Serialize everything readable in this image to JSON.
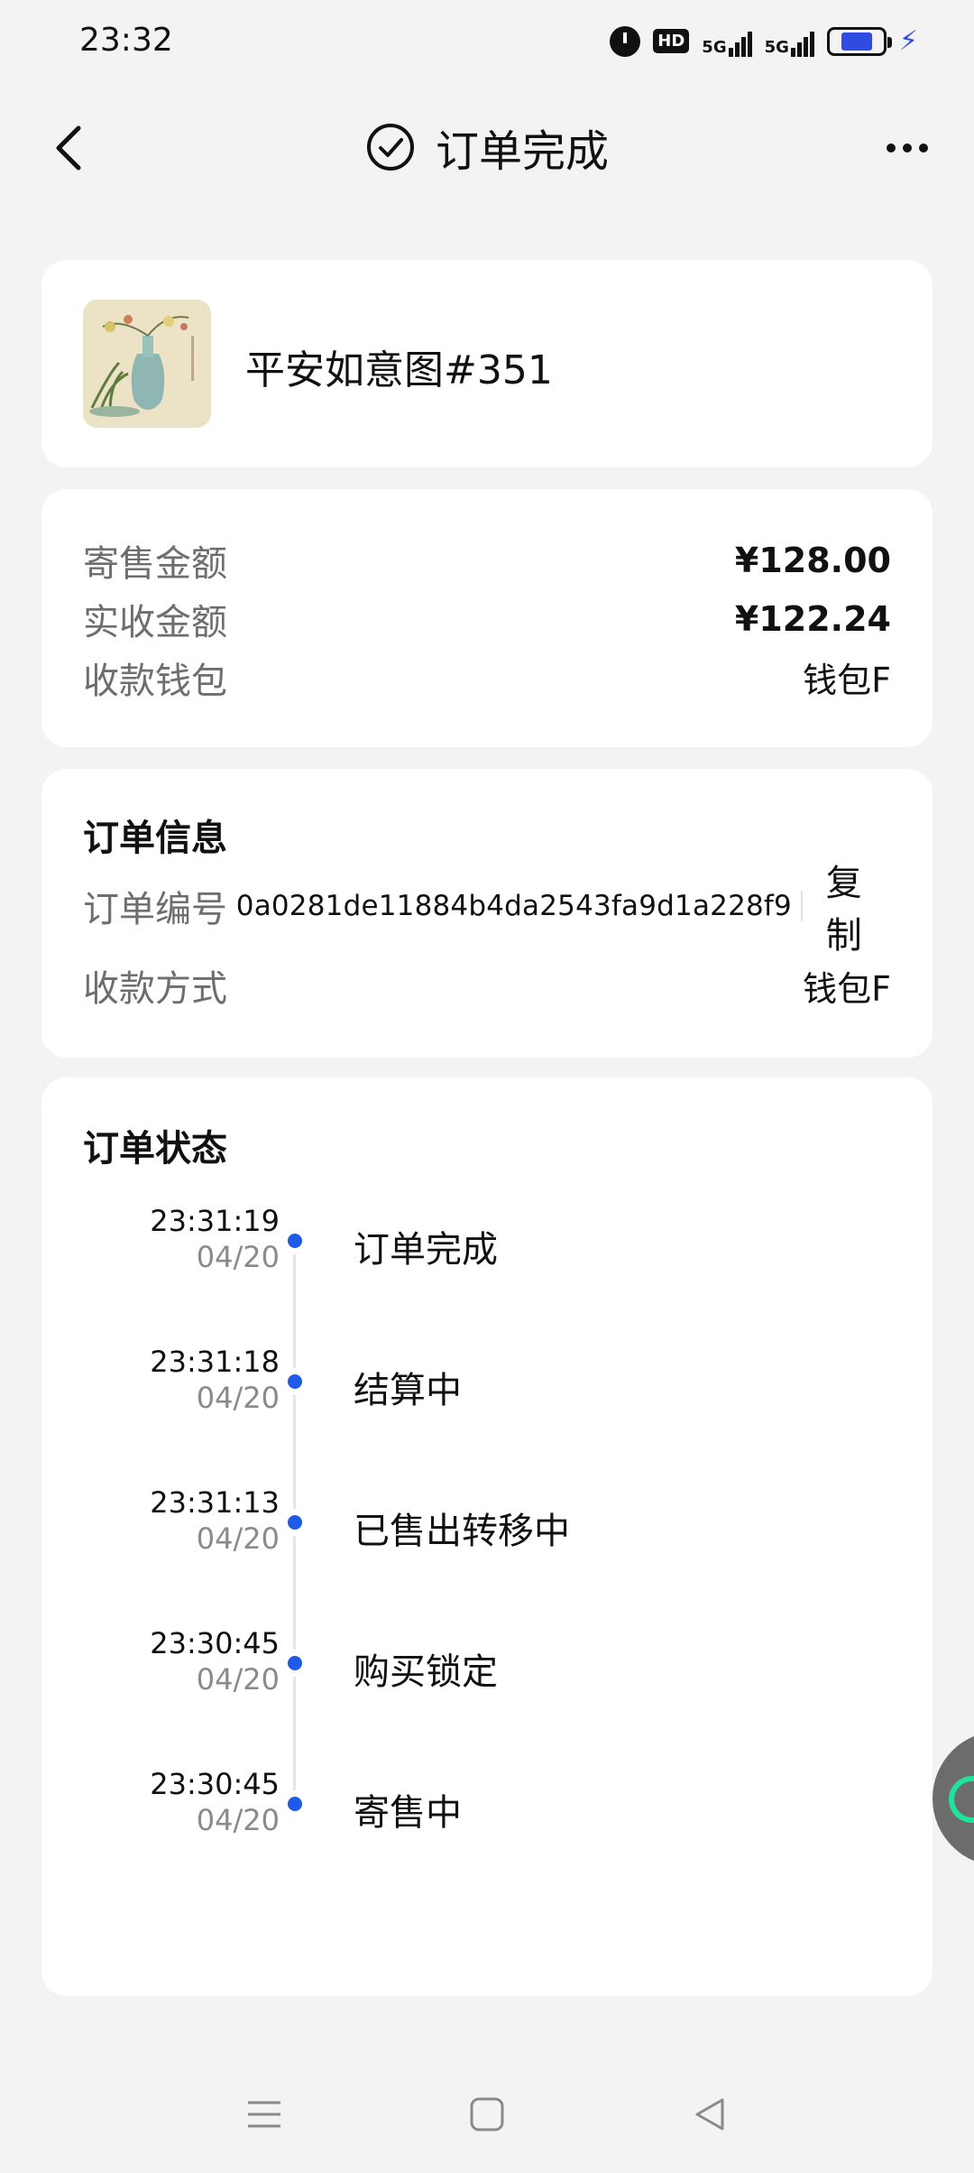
{
  "status_bar": {
    "time": "23:32",
    "icons": [
      "alarm-icon",
      "hd-icon",
      "signal-5g-icon",
      "signal-5g-icon",
      "battery-icon",
      "charging-bolt-icon"
    ],
    "hd_label": "HD",
    "signal_label": "5G",
    "battery_color": "#2f4be0"
  },
  "header": {
    "title": "订单完成",
    "back_icon": "chevron-left-icon",
    "status_icon": "check-circle-icon",
    "more_icon": "more-horizontal-icon"
  },
  "product": {
    "name": "平安如意图#351",
    "thumbnail": "vase-painting-thumbnail"
  },
  "amounts": {
    "rows": [
      {
        "label": "寄售金额",
        "value": "¥128.00"
      },
      {
        "label": "实收金额",
        "value": "¥122.24"
      },
      {
        "label": "收款钱包",
        "value": "钱包F"
      }
    ]
  },
  "order_info": {
    "title": "订单信息",
    "order_no_label": "订单编号",
    "order_no": "0a0281de11884b4da2543fa9d1a228f9",
    "copy_label": "复制",
    "payment_label": "收款方式",
    "payment_value": "钱包F"
  },
  "order_status": {
    "title": "订单状态",
    "accent_color": "#1f5ae8",
    "events": [
      {
        "time": "23:31:19",
        "date": "04/20",
        "label": "订单完成"
      },
      {
        "time": "23:31:18",
        "date": "04/20",
        "label": "结算中"
      },
      {
        "time": "23:31:13",
        "date": "04/20",
        "label": "已售出转移中"
      },
      {
        "time": "23:30:45",
        "date": "04/20",
        "label": "购买锁定"
      },
      {
        "time": "23:30:45",
        "date": "04/20",
        "label": "寄售中"
      }
    ]
  },
  "nav_bar": {
    "icons": [
      "menu-icon",
      "home-square-icon",
      "back-triangle-icon"
    ]
  }
}
